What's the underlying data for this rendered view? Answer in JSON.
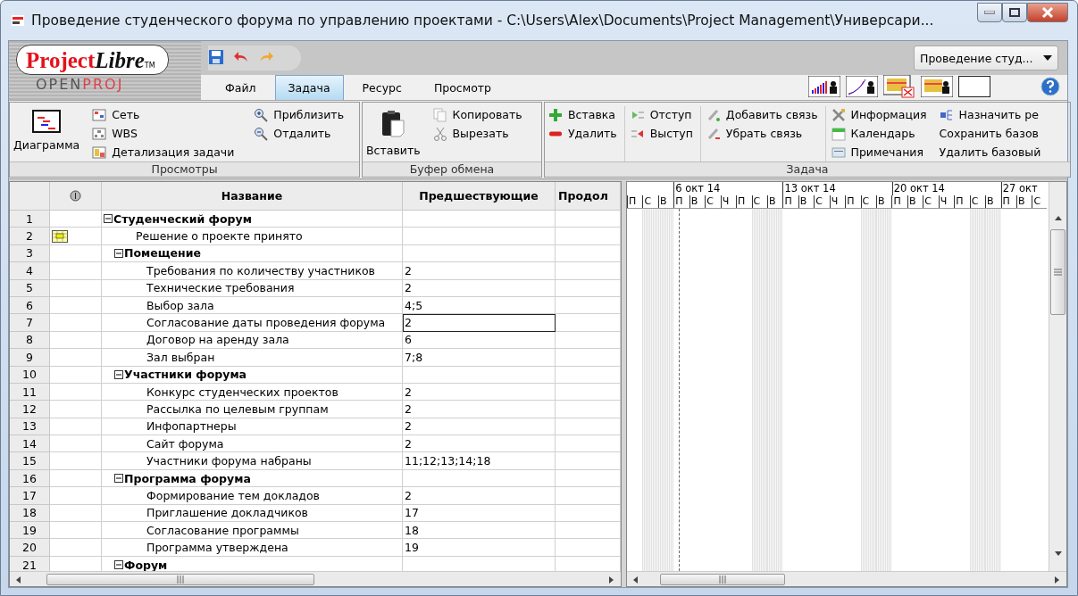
{
  "window": {
    "title": "Проведение студенческого форума по управлению проектами - C:\\Users\\Alex\\Documents\\Project Management\\Универсари..."
  },
  "logo": {
    "name_a": "Project",
    "name_b": "Libre",
    "tm": "TM",
    "sub_a": "OPEN",
    "sub_b": "PROJ"
  },
  "project_selector": {
    "value": "Проведение студ..."
  },
  "menu_tabs": [
    {
      "label": "Файл",
      "selected": false
    },
    {
      "label": "Задача",
      "selected": true
    },
    {
      "label": "Ресурс",
      "selected": false
    },
    {
      "label": "Просмотр",
      "selected": false
    }
  ],
  "ribbon": {
    "views": {
      "caption": "Просмотры",
      "big": "Диаграмма",
      "items": [
        "Сеть",
        "WBS",
        "Детализация задачи"
      ],
      "zoom": [
        "Приблизить",
        "Отдалить"
      ]
    },
    "clipboard": {
      "caption": "Буфер обмена",
      "big": "Вставить",
      "items": [
        "Копировать",
        "Вырезать"
      ]
    },
    "task": {
      "caption": "Задача",
      "cols": [
        [
          "Вставка",
          "Удалить"
        ],
        [
          "Отступ",
          "Выступ"
        ],
        [
          "Добавить связь",
          "Убрать связь"
        ],
        [
          "Информация",
          "Календарь",
          "Примечания"
        ],
        [
          "Назначить ре",
          "Сохранить базов",
          "Удалить базовый"
        ]
      ]
    }
  },
  "table": {
    "columns": [
      "Название",
      "Предшествующие",
      "Продол"
    ],
    "tasks": [
      {
        "number": "1",
        "name": "Студенческий форум",
        "indicator": false,
        "selected": false,
        "expanded": true,
        "children": [
          {
            "number": "2",
            "name": "Решение о проекте принято",
            "indicator": true,
            "selected": false
          },
          {
            "number": "3",
            "name": "Помещение",
            "indicator": false,
            "selected": false,
            "expanded": true,
            "children": [
              {
                "number": "4",
                "name": "Требования по количеству участников",
                "predecessors": "2",
                "indicator": false,
                "selected": false
              },
              {
                "number": "5",
                "name": "Технические требования",
                "predecessors": "2",
                "indicator": false,
                "selected": false
              },
              {
                "number": "6",
                "name": "Выбор зала",
                "predecessors": "4;5",
                "indicator": false,
                "selected": false
              },
              {
                "number": "7",
                "name": "Согласование даты проведения форума",
                "predecessors": "2",
                "indicator": false,
                "selected": true
              },
              {
                "number": "8",
                "name": "Договор на аренду зала",
                "predecessors": "6",
                "indicator": false,
                "selected": false
              },
              {
                "number": "9",
                "name": "Зал выбран",
                "predecessors": "7;8",
                "indicator": false,
                "selected": false
              }
            ]
          },
          {
            "number": "10",
            "name": "Участники форума",
            "indicator": false,
            "selected": false,
            "expanded": true,
            "children": [
              {
                "number": "11",
                "name": "Конкурс студенческих проектов",
                "predecessors": "2",
                "indicator": false,
                "selected": false
              },
              {
                "number": "12",
                "name": "Рассылка по целевым группам",
                "predecessors": "2",
                "indicator": false,
                "selected": false
              },
              {
                "number": "13",
                "name": "Инфопартнеры",
                "predecessors": "2",
                "indicator": false,
                "selected": false
              },
              {
                "number": "14",
                "name": "Сайт форума",
                "predecessors": "2",
                "indicator": false,
                "selected": false
              },
              {
                "number": "15",
                "name": "Участники форума набраны",
                "predecessors": "11;12;13;14;18",
                "indicator": false,
                "selected": false
              }
            ]
          },
          {
            "number": "16",
            "name": "Программа форума",
            "indicator": false,
            "selected": false,
            "expanded": true,
            "children": [
              {
                "number": "17",
                "name": "Формирование тем докладов",
                "predecessors": "2",
                "indicator": false,
                "selected": false
              },
              {
                "number": "18",
                "name": "Приглашение докладчиков",
                "predecessors": "17",
                "indicator": false,
                "selected": false
              },
              {
                "number": "19",
                "name": "Согласование программы",
                "predecessors": "18",
                "indicator": false,
                "selected": false
              },
              {
                "number": "20",
                "name": "Программа утверждена",
                "predecessors": "19",
                "indicator": false,
                "selected": false
              }
            ]
          },
          {
            "number": "21",
            "name": "Форум",
            "indicator": false,
            "selected": false,
            "expanded": true
          }
        ]
      }
    ]
  },
  "gantt": {
    "weeks": [
      "6 окт 14",
      "13 окт 14",
      "20 окт 14",
      "27 окт"
    ],
    "days": [
      {
        "label": "П",
        "weekend": false
      },
      {
        "label": "С",
        "weekend": true
      },
      {
        "label": "В",
        "weekend": true
      },
      {
        "label": "П",
        "weekend": false
      },
      {
        "label": "В",
        "weekend": false
      },
      {
        "label": "С",
        "weekend": false
      },
      {
        "label": "Ч",
        "weekend": false
      },
      {
        "label": "П",
        "weekend": false
      },
      {
        "label": "С",
        "weekend": true
      },
      {
        "label": "В",
        "weekend": true
      },
      {
        "label": "П",
        "weekend": false
      },
      {
        "label": "В",
        "weekend": false
      },
      {
        "label": "С",
        "weekend": false
      },
      {
        "label": "Ч",
        "weekend": false
      },
      {
        "label": "П",
        "weekend": false
      },
      {
        "label": "С",
        "weekend": true
      },
      {
        "label": "В",
        "weekend": true
      },
      {
        "label": "П",
        "weekend": false
      },
      {
        "label": "В",
        "weekend": false
      },
      {
        "label": "С",
        "weekend": false
      },
      {
        "label": "Ч",
        "weekend": false
      },
      {
        "label": "П",
        "weekend": false
      },
      {
        "label": "С",
        "weekend": true
      },
      {
        "label": "В",
        "weekend": true
      },
      {
        "label": "П",
        "weekend": false
      },
      {
        "label": "В",
        "weekend": false
      },
      {
        "label": "С",
        "weekend": false
      }
    ]
  }
}
